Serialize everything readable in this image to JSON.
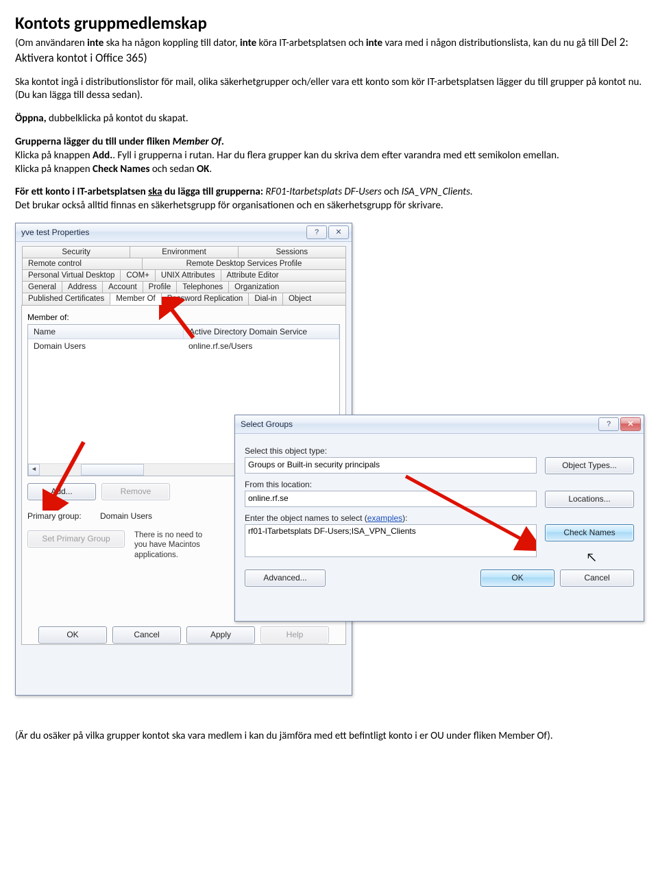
{
  "doc": {
    "h1": "Kontots gruppmedlemskap",
    "intro1a": "(Om användaren ",
    "intro1b": "inte",
    "intro1c": " ska ha någon koppling till dator, ",
    "intro1d": "inte",
    "intro1e": " köra IT-arbetsplatsen och ",
    "intro1f": "inte",
    "intro1g": " vara med i någon distributionslista, kan du nu gå till ",
    "intro1h": "Del 2: Aktivera kontot i Office 365)",
    "p2": "Ska kontot ingå i distributionslistor för mail, olika säkerhetgrupper och/eller vara ett konto som kör IT-arbetsplatsen lägger du till grupper på kontot nu. (Du kan lägga till dessa sedan).",
    "p3a": "Öppna,",
    "p3b": " dubbelklicka på kontot du skapat.",
    "p4a": "Grupperna lägger du till under fliken ",
    "p4b": "Member Of",
    "p4c": ".",
    "p5a": "Klicka på knappen ",
    "p5b": "Add.",
    "p5c": ". Fyll i grupperna i rutan. Har du flera grupper kan du skriva dem efter varandra med ett semikolon emellan.",
    "p6a": "Klicka på knappen ",
    "p6b": "Check Names",
    "p6c": " och sedan ",
    "p6d": "OK",
    "p6e": ".",
    "p7a": "För ett konto i IT-arbetsplatsen ",
    "p7b": "ska",
    "p7c": " du lägga till grupperna: ",
    "p7d": "RF01-Itarbetsplats DF-Users",
    "p7e": "   och ",
    "p7f": "ISA_VPN_Clients.",
    "p8": "Det brukar också alltid finnas en säkerhetsgrupp för organisationen och en säkerhetsgrupp för skrivare.",
    "footer": "(Är du osäker på vilka grupper kontot ska vara medlem i kan du jämföra med ett befintligt konto i er OU under fliken Member Of)."
  },
  "propwin": {
    "title": "yve test Properties",
    "tabs_row1": [
      "Security",
      "Environment",
      "Sessions"
    ],
    "tabs_row2": [
      "Remote control",
      "Remote Desktop Services Profile"
    ],
    "tabs_row3": [
      "Personal Virtual Desktop",
      "COM+",
      "UNIX Attributes",
      "Attribute Editor"
    ],
    "tabs_row4": [
      "General",
      "Address",
      "Account",
      "Profile",
      "Telephones",
      "Organization"
    ],
    "tabs_row5": [
      "Published Certificates",
      "Member Of",
      "Password Replication",
      "Dial-in",
      "Object"
    ],
    "member_of_label": "Member of:",
    "col_name": "Name",
    "col_svc": "Active Directory Domain Service",
    "row_name": "Domain Users",
    "row_svc": "online.rf.se/Users",
    "btn_add": "Add...",
    "btn_remove": "Remove",
    "pg_label": "Primary group:",
    "pg_value": "Domain Users",
    "btn_setpg": "Set Primary Group",
    "pg_hint": "There is no need to you have Macintos applications.",
    "btn_ok": "OK",
    "btn_cancel": "Cancel",
    "btn_apply": "Apply",
    "btn_help": "Help"
  },
  "sg": {
    "title": "Select Groups",
    "l1": "Select this object type:",
    "v1": "Groups or Built-in security principals",
    "b1": "Object Types...",
    "l2": "From this location:",
    "v2": "online.rf.se",
    "b2": "Locations...",
    "l3a": "Enter the object names to select (",
    "l3b": "examples",
    "l3c": "):",
    "v3": "rf01-ITarbetsplats DF-Users;ISA_VPN_Clients",
    "b3": "Check Names",
    "b_adv": "Advanced...",
    "b_ok": "OK",
    "b_cancel": "Cancel"
  }
}
